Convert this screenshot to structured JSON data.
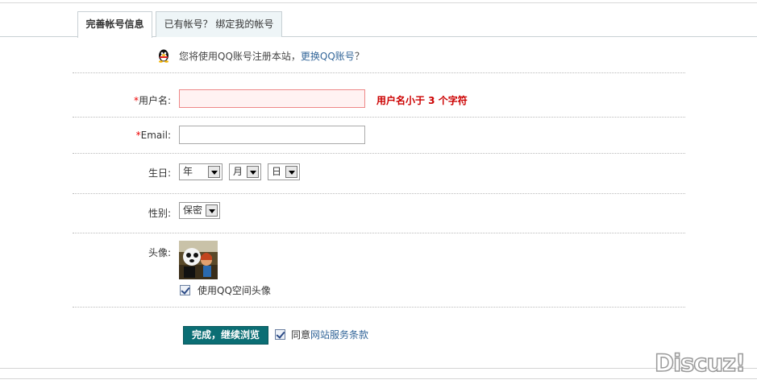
{
  "tabs": [
    {
      "label": "完善帐号信息",
      "active": true
    },
    {
      "label": "已有帐号？ 绑定我的帐号",
      "active": false
    }
  ],
  "info": {
    "icon": "qq-penguin-icon",
    "text": "您将使用QQ账号注册本站，",
    "link": "更换QQ账号",
    "suffix": "？"
  },
  "form": {
    "username": {
      "required_mark": "*",
      "label": "用户名:",
      "value": "",
      "error": "用户名小于 3 个字符"
    },
    "email": {
      "required_mark": "*",
      "label": "Email:",
      "value": ""
    },
    "birthday": {
      "label": "生日:",
      "year": "年",
      "month": "月",
      "day": "日"
    },
    "gender": {
      "label": "性别:",
      "value": "保密"
    },
    "avatar": {
      "label": "头像:",
      "checkbox_label": "使用QQ空间头像",
      "checked": true
    }
  },
  "footer": {
    "submit_label": "完成，继续浏览",
    "agree_text": "同意",
    "terms_link": "网站服务条款",
    "agree_checked": true
  },
  "watermark": "Discuz!",
  "colors": {
    "accent": "#0b6e74",
    "error": "#cc0000",
    "link": "#336699",
    "tab_inactive_bg": "#eef5f7"
  }
}
